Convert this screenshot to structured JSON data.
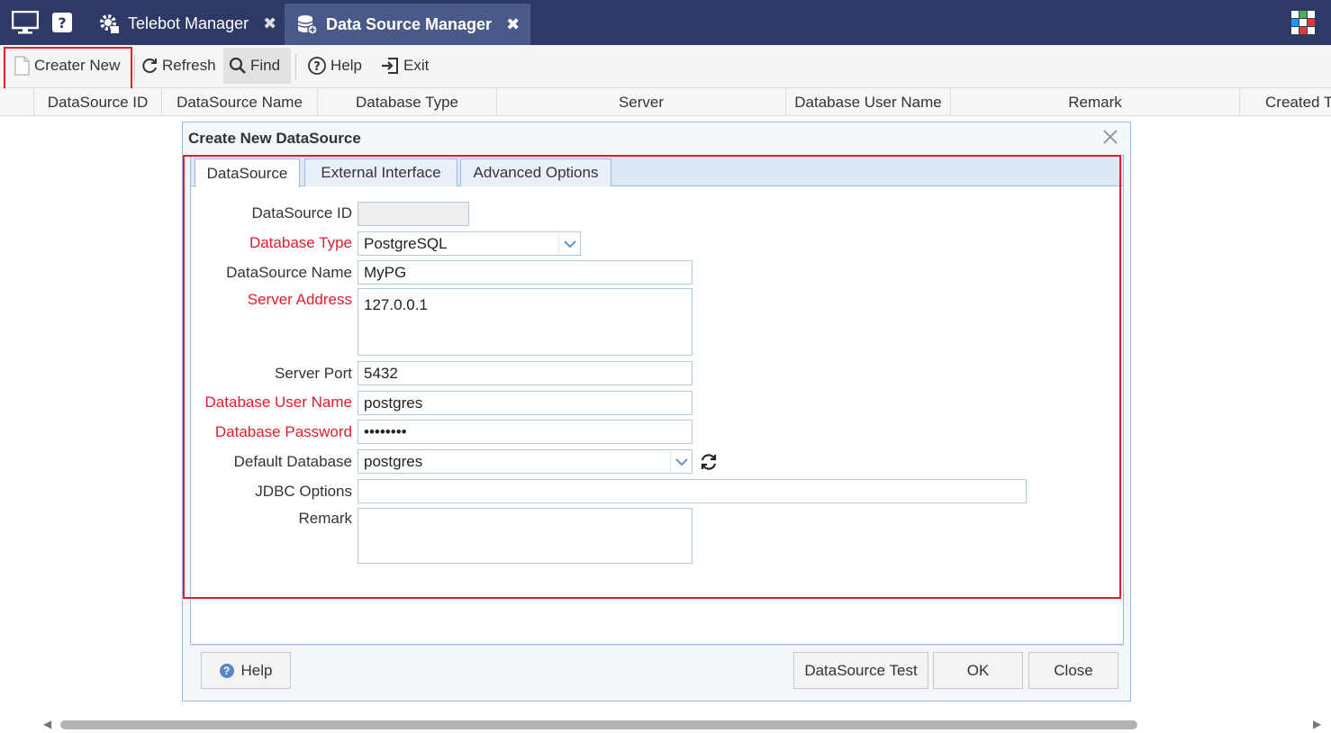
{
  "titlebar": {
    "tabs": [
      {
        "label": "Telebot Manager",
        "close": "✖"
      },
      {
        "label": "Data Source Manager",
        "close": "✖"
      }
    ]
  },
  "toolbar": {
    "creater_new": "Creater New",
    "refresh": "Refresh",
    "find": "Find",
    "help": "Help",
    "exit": "Exit"
  },
  "grid": {
    "columns": [
      "DataSource ID",
      "DataSource Name",
      "Database Type",
      "Server",
      "Database User Name",
      "Remark",
      "Created T"
    ]
  },
  "dialog": {
    "title": "Create New DataSource",
    "tabs": [
      "DataSource",
      "External Interface",
      "Advanced Options"
    ],
    "fields": {
      "datasource_id": {
        "label": "DataSource ID",
        "value": ""
      },
      "database_type": {
        "label": "Database Type",
        "value": "PostgreSQL"
      },
      "datasource_name": {
        "label": "DataSource Name",
        "value": "MyPG"
      },
      "server_address": {
        "label": "Server Address",
        "value": "127.0.0.1"
      },
      "server_port": {
        "label": "Server Port",
        "value": "5432"
      },
      "db_user": {
        "label": "Database User Name",
        "value": "postgres"
      },
      "db_password": {
        "label": "Database Password",
        "value": "••••••••"
      },
      "default_db": {
        "label": "Default Database",
        "value": "postgres"
      },
      "jdbc_options": {
        "label": "JDBC Options",
        "value": ""
      },
      "remark": {
        "label": "Remark",
        "value": ""
      }
    },
    "buttons": {
      "help": "Help",
      "test": "DataSource Test",
      "ok": "OK",
      "close": "Close"
    }
  },
  "colors": {
    "titlebar": "#2e3a66",
    "required_label": "#e01e2b",
    "highlight_box": "#e01e2b",
    "dialog_border": "#99bbe8"
  }
}
